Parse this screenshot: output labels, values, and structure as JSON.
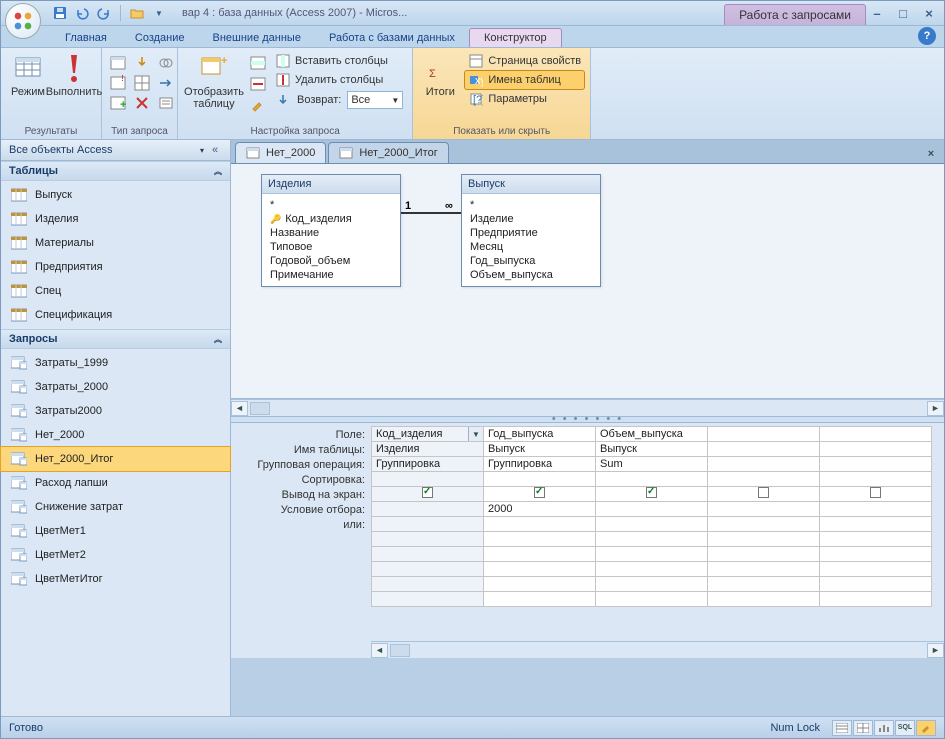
{
  "title": "вар 4 : база данных (Access 2007) - Micros...",
  "context_tab": "Работа с запросами",
  "ribbon_tabs": [
    "Главная",
    "Создание",
    "Внешние данные",
    "Работа с базами данных",
    "Конструктор"
  ],
  "active_ribbon_tab": "Конструктор",
  "ribbon": {
    "results": {
      "view": "Режим",
      "run": "Выполнить",
      "label": "Результаты"
    },
    "query_type": {
      "label": "Тип запроса"
    },
    "setup": {
      "show_table": "Отобразить таблицу",
      "insert_cols": "Вставить столбцы",
      "delete_cols": "Удалить столбцы",
      "return_lbl": "Возврат:",
      "return_val": "Все",
      "label": "Настройка запроса"
    },
    "showhide": {
      "totals": "Итоги",
      "propsheet": "Страница свойств",
      "tablenames": "Имена таблиц",
      "params": "Параметры",
      "label": "Показать или скрыть"
    }
  },
  "nav": {
    "title": "Все объекты Access",
    "sections": {
      "tables": {
        "label": "Таблицы",
        "items": [
          "Выпуск",
          "Изделия",
          "Материалы",
          "Предприятия",
          "Спец",
          "Спецификация"
        ]
      },
      "queries": {
        "label": "Запросы",
        "items": [
          "Затраты_1999",
          "Затраты_2000",
          "Затраты2000",
          "Нет_2000",
          "Нет_2000_Итог",
          "Расход лапши",
          "Снижение затрат",
          "ЦветМет1",
          "ЦветМет2",
          "ЦветМетИтог"
        ],
        "selected": "Нет_2000_Итог"
      }
    }
  },
  "doc_tabs": [
    "Нет_2000",
    "Нет_2000_Итог"
  ],
  "active_doc_tab": "Нет_2000",
  "diagram": {
    "left": {
      "title": "Изделия",
      "fields": [
        "*",
        "Код_изделия",
        "Название",
        "Типовое",
        "Годовой_объем",
        "Примечание"
      ],
      "key": "Код_изделия"
    },
    "right": {
      "title": "Выпуск",
      "fields": [
        "*",
        "Изделие",
        "Предприятие",
        "Месяц",
        "Год_выпуска",
        "Объем_выпуска"
      ]
    },
    "rel": {
      "left": "1",
      "right": "∞"
    }
  },
  "grid": {
    "row_labels": [
      "Поле:",
      "Имя таблицы:",
      "Групповая операция:",
      "Сортировка:",
      "Вывод на экран:",
      "Условие отбора:",
      "или:"
    ],
    "cols": [
      {
        "field": "Код_изделия",
        "table": "Изделия",
        "group": "Группировка",
        "show": true,
        "criteria": ""
      },
      {
        "field": "Год_выпуска",
        "table": "Выпуск",
        "group": "Группировка",
        "show": true,
        "criteria": "2000"
      },
      {
        "field": "Объем_выпуска",
        "table": "Выпуск",
        "group": "Sum",
        "show": true,
        "criteria": ""
      },
      {
        "field": "",
        "table": "",
        "group": "",
        "show": false,
        "criteria": ""
      },
      {
        "field": "",
        "table": "",
        "group": "",
        "show": false,
        "criteria": ""
      }
    ]
  },
  "status": {
    "ready": "Готово",
    "numlock": "Num Lock"
  }
}
